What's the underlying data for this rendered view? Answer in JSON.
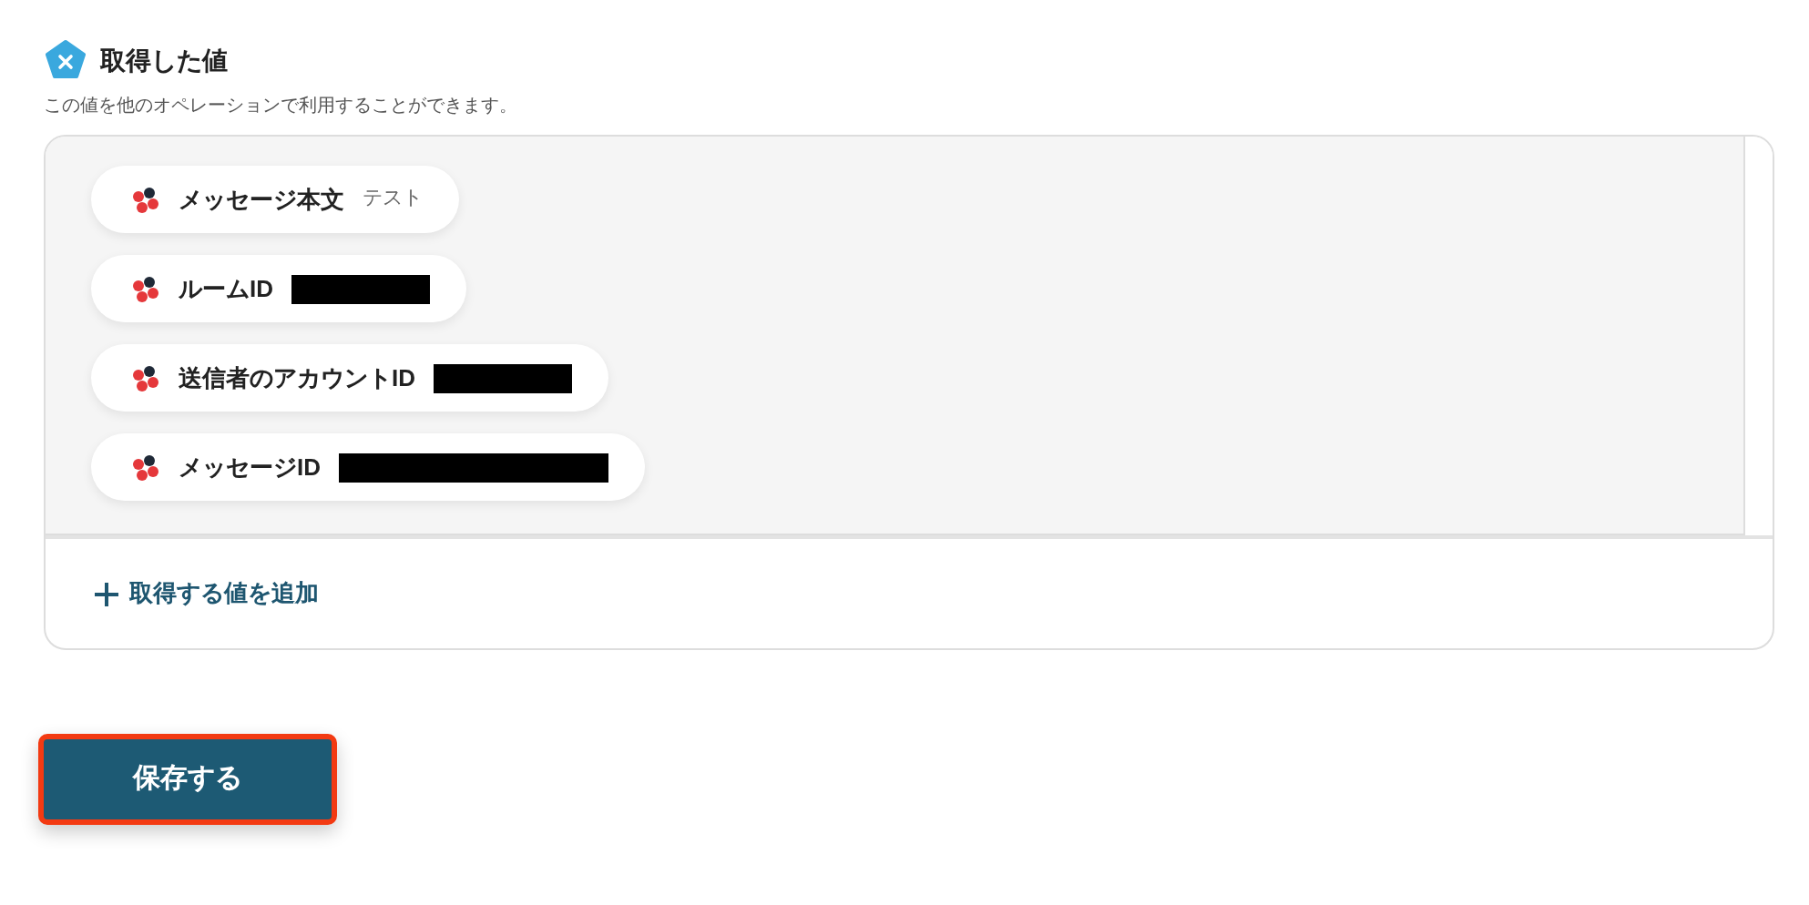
{
  "section": {
    "title": "取得した値",
    "description": "この値を他のオペレーションで利用することができます。"
  },
  "values": [
    {
      "label": "メッセージ本文",
      "value": "テスト",
      "redacted": false
    },
    {
      "label": "ルームID",
      "redacted": true
    },
    {
      "label": "送信者のアカウントID",
      "redacted": true
    },
    {
      "label": "メッセージID",
      "redacted": true
    }
  ],
  "add_button": {
    "label": "取得する値を追加"
  },
  "save_button": {
    "label": "保存する",
    "highlighted": true
  }
}
